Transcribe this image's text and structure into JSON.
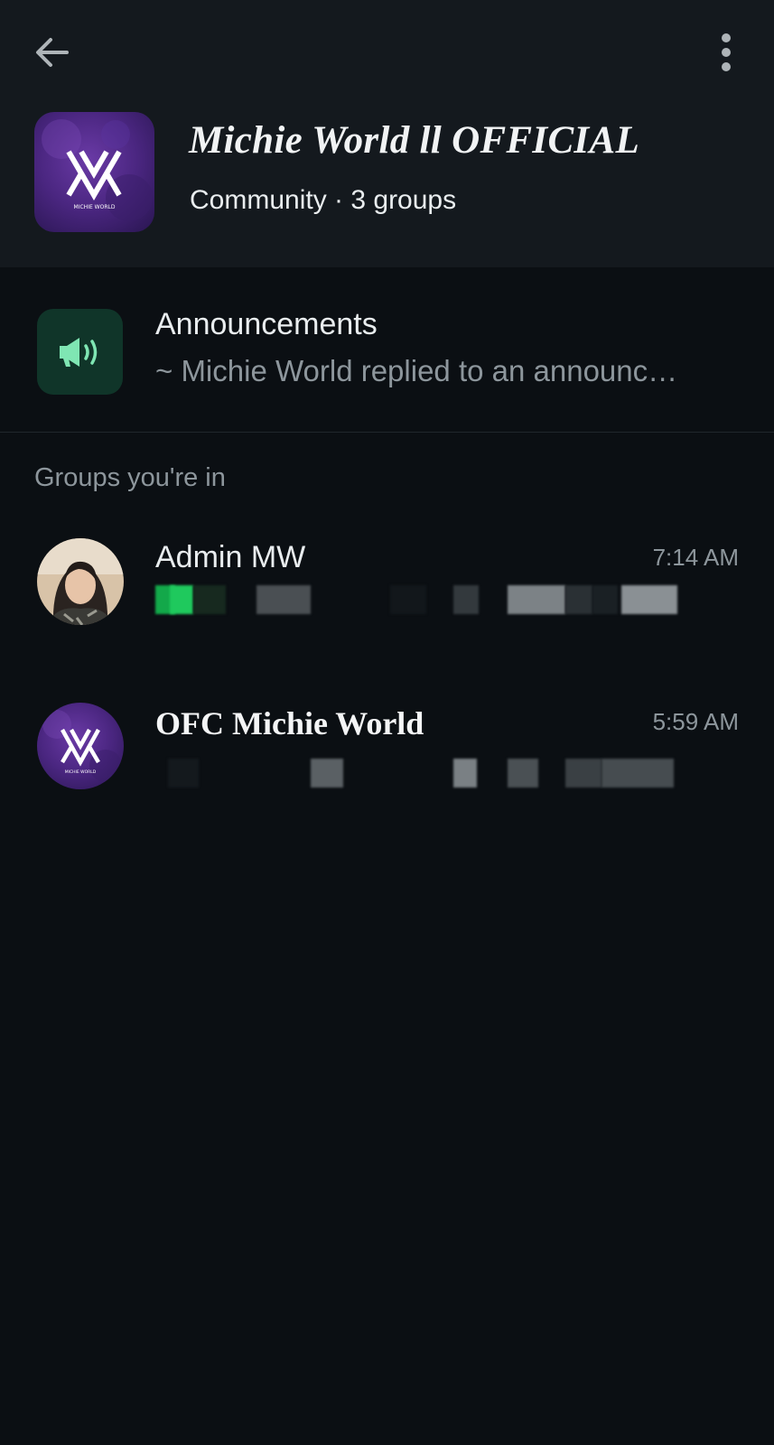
{
  "header": {
    "back_icon": "arrow-left-icon",
    "menu_icon": "more-vertical-icon",
    "community_name": "Michie World ll OFFICIAL",
    "community_meta": "Community · 3 groups",
    "avatar_icon": "michie-world-logo",
    "avatar_logo_text": "MICHIE WORLD"
  },
  "announcements": {
    "icon": "megaphone-icon",
    "title": "Announcements",
    "preview": "~ Michie World replied to an announc…"
  },
  "groups_section": {
    "label": "Groups you're in",
    "groups": [
      {
        "name": "Admin MW",
        "time": "7:14 AM",
        "avatar_icon": "profile-photo",
        "preview_blurred": true
      },
      {
        "name": "OFC Michie World",
        "time": "5:59 AM",
        "avatar_icon": "michie-world-logo",
        "avatar_logo_text": "MICHIE WORLD",
        "preview_blurred": true
      }
    ]
  },
  "colors": {
    "background": "#0b0f13",
    "header_background": "#14191e",
    "announce_icon_bg": "#103529",
    "announce_icon_fg": "#7fe6b3",
    "muted_text": "#8d969c",
    "primary_text": "#e9edef",
    "avatar_purple": "#4a2a7a"
  }
}
